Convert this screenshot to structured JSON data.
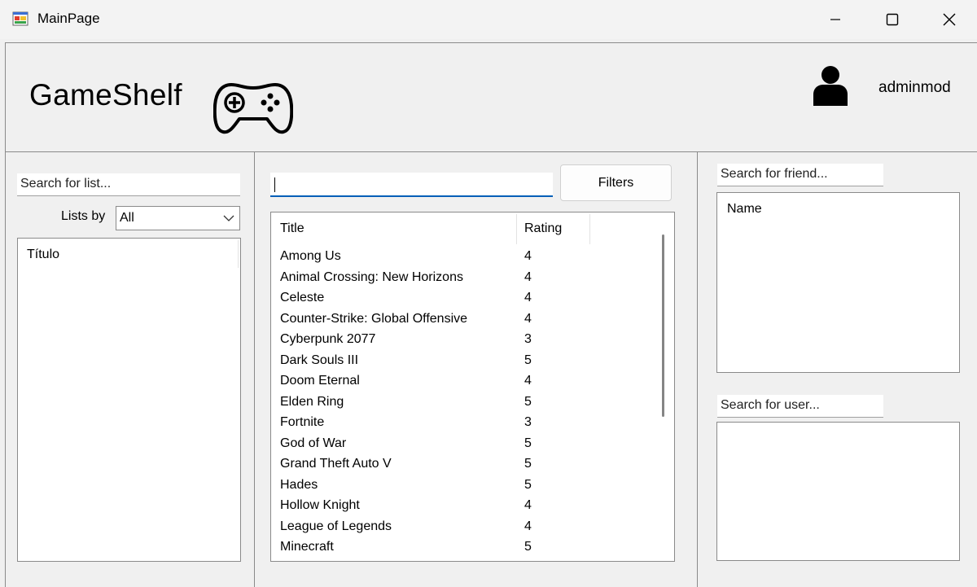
{
  "window": {
    "title": "MainPage"
  },
  "header": {
    "app_name": "GameShelf",
    "username": "adminmod"
  },
  "left_panel": {
    "search_placeholder": "Search for list...",
    "lists_by_label": "Lists by",
    "lists_by_value": "All",
    "list_column_header": "Título"
  },
  "center_panel": {
    "search_value": "",
    "filters_label": "Filters",
    "columns": {
      "title": "Title",
      "rating": "Rating"
    },
    "games": [
      {
        "title": "Among Us",
        "rating": "4"
      },
      {
        "title": "Animal Crossing: New Horizons",
        "rating": "4"
      },
      {
        "title": "Celeste",
        "rating": "4"
      },
      {
        "title": "Counter-Strike: Global Offensive",
        "rating": "4"
      },
      {
        "title": "Cyberpunk 2077",
        "rating": "3"
      },
      {
        "title": "Dark Souls III",
        "rating": "5"
      },
      {
        "title": "Doom Eternal",
        "rating": "4"
      },
      {
        "title": "Elden Ring",
        "rating": "5"
      },
      {
        "title": "Fortnite",
        "rating": "3"
      },
      {
        "title": "God of War",
        "rating": "5"
      },
      {
        "title": "Grand Theft Auto V",
        "rating": "5"
      },
      {
        "title": "Hades",
        "rating": "5"
      },
      {
        "title": "Hollow Knight",
        "rating": "4"
      },
      {
        "title": "League of Legends",
        "rating": "4"
      },
      {
        "title": "Minecraft",
        "rating": "5"
      }
    ]
  },
  "right_panel": {
    "friend_search_placeholder": "Search for friend...",
    "friends_column_header": "Name",
    "user_search_placeholder": "Search for user..."
  },
  "colors": {
    "accent": "#005fb8",
    "window_bg": "#f0f0f0",
    "border": "#8a8a8a"
  },
  "icons": {
    "app": "app-window-icon",
    "logo": "gamepad-icon",
    "user": "user-avatar-icon",
    "minimize": "minimize-icon",
    "maximize": "maximize-icon",
    "close": "close-icon"
  }
}
